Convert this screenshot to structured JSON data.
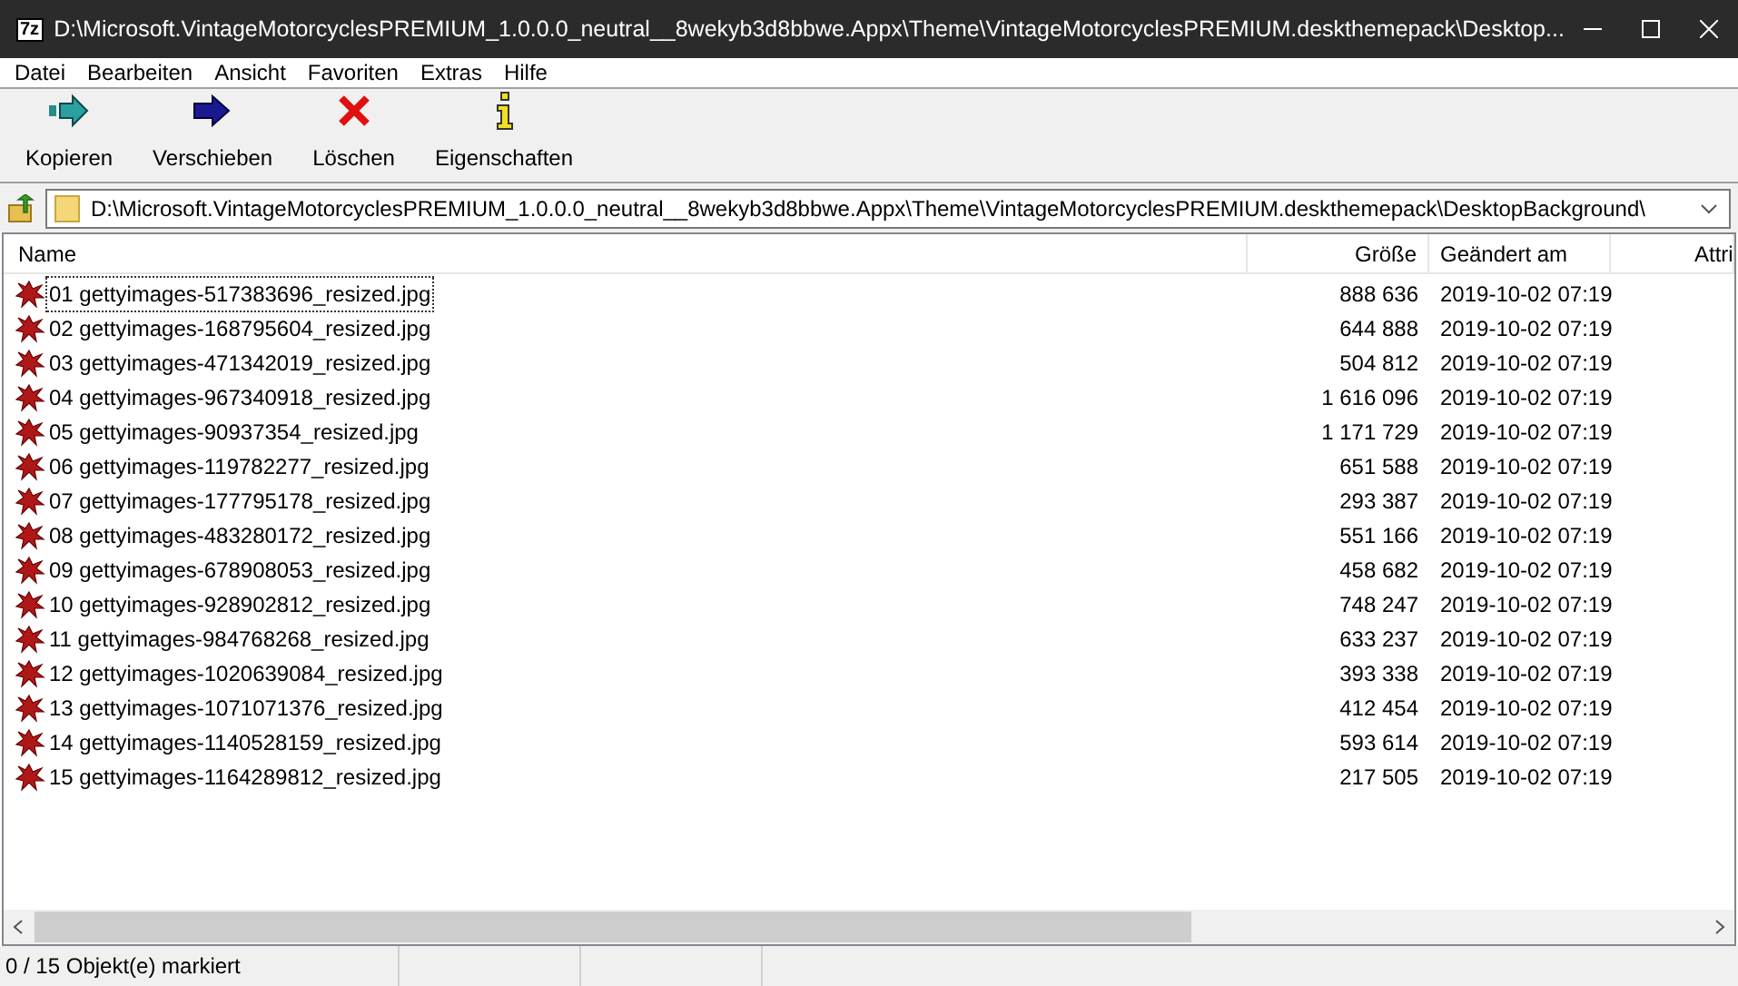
{
  "window": {
    "app_icon": "7z",
    "title": "D:\\Microsoft.VintageMotorcyclesPREMIUM_1.0.0.0_neutral__8wekyb3d8bbwe.Appx\\Theme\\VintageMotorcyclesPREMIUM.deskthemepack\\Desktop..."
  },
  "menu": [
    "Datei",
    "Bearbeiten",
    "Ansicht",
    "Favoriten",
    "Extras",
    "Hilfe"
  ],
  "toolbar": [
    {
      "kind": "copy",
      "label": "Kopieren"
    },
    {
      "kind": "move",
      "label": "Verschieben"
    },
    {
      "kind": "delete",
      "label": "Löschen"
    },
    {
      "kind": "info",
      "label": "Eigenschaften"
    }
  ],
  "address": {
    "value": "D:\\Microsoft.VintageMotorcyclesPREMIUM_1.0.0.0_neutral__8wekyb3d8bbwe.Appx\\Theme\\VintageMotorcyclesPREMIUM.deskthemepack\\DesktopBackground\\"
  },
  "table": {
    "columns": [
      "Name",
      "Größe",
      "Geändert am",
      "Attri"
    ],
    "rows": [
      {
        "name": "01 gettyimages-517383696_resized.jpg",
        "size": "888 636",
        "modified": "2019-10-02 07:19",
        "focused": true
      },
      {
        "name": "02 gettyimages-168795604_resized.jpg",
        "size": "644 888",
        "modified": "2019-10-02 07:19",
        "focused": false
      },
      {
        "name": "03 gettyimages-471342019_resized.jpg",
        "size": "504 812",
        "modified": "2019-10-02 07:19",
        "focused": false
      },
      {
        "name": "04 gettyimages-967340918_resized.jpg",
        "size": "1 616 096",
        "modified": "2019-10-02 07:19",
        "focused": false
      },
      {
        "name": "05 gettyimages-90937354_resized.jpg",
        "size": "1 171 729",
        "modified": "2019-10-02 07:19",
        "focused": false
      },
      {
        "name": "06 gettyimages-119782277_resized.jpg",
        "size": "651 588",
        "modified": "2019-10-02 07:19",
        "focused": false
      },
      {
        "name": "07 gettyimages-177795178_resized.jpg",
        "size": "293 387",
        "modified": "2019-10-02 07:19",
        "focused": false
      },
      {
        "name": "08 gettyimages-483280172_resized.jpg",
        "size": "551 166",
        "modified": "2019-10-02 07:19",
        "focused": false
      },
      {
        "name": "09 gettyimages-678908053_resized.jpg",
        "size": "458 682",
        "modified": "2019-10-02 07:19",
        "focused": false
      },
      {
        "name": "10 gettyimages-928902812_resized.jpg",
        "size": "748 247",
        "modified": "2019-10-02 07:19",
        "focused": false
      },
      {
        "name": "11 gettyimages-984768268_resized.jpg",
        "size": "633 237",
        "modified": "2019-10-02 07:19",
        "focused": false
      },
      {
        "name": "12 gettyimages-1020639084_resized.jpg",
        "size": "393 338",
        "modified": "2019-10-02 07:19",
        "focused": false
      },
      {
        "name": "13 gettyimages-1071071376_resized.jpg",
        "size": "412 454",
        "modified": "2019-10-02 07:19",
        "focused": false
      },
      {
        "name": "14 gettyimages-1140528159_resized.jpg",
        "size": "593 614",
        "modified": "2019-10-02 07:19",
        "focused": false
      },
      {
        "name": "15 gettyimages-1164289812_resized.jpg",
        "size": "217 505",
        "modified": "2019-10-02 07:19",
        "focused": false
      }
    ]
  },
  "status_bar": {
    "text": "0 / 15 Objekt(e) markiert"
  }
}
